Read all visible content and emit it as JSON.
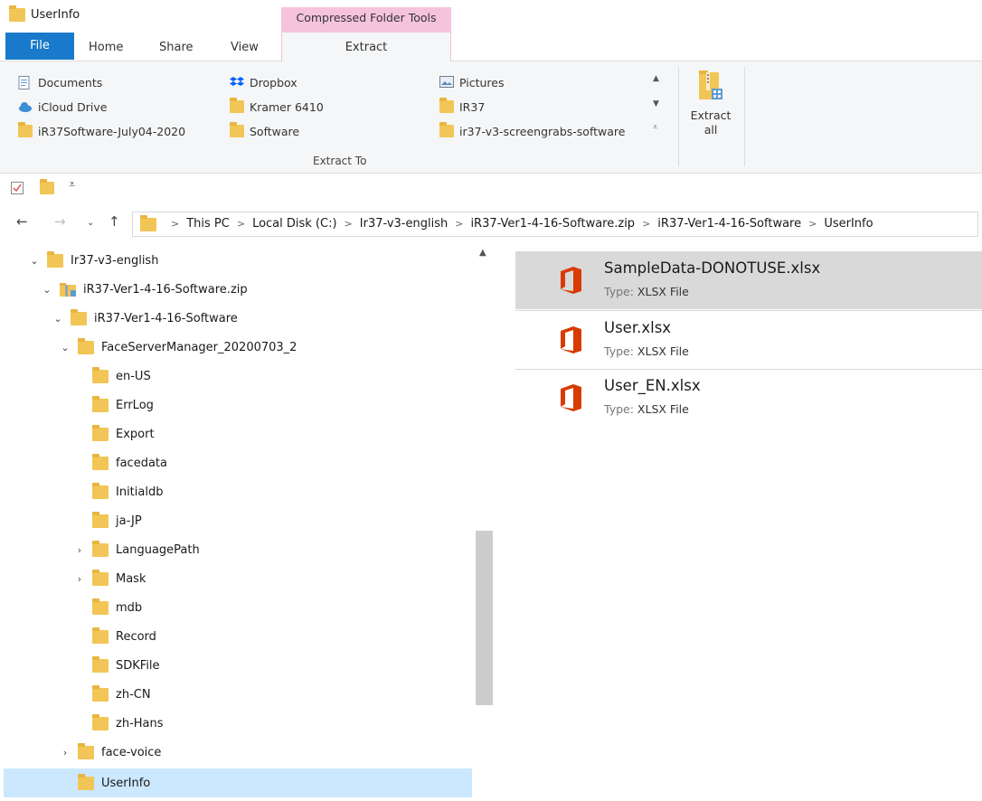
{
  "window": {
    "title": "UserInfo"
  },
  "ribbon": {
    "context_header": "Compressed Folder Tools",
    "tabs": {
      "file": "File",
      "home": "Home",
      "share": "Share",
      "view": "View",
      "extract": "Extract"
    },
    "extract_to": {
      "label": "Extract To",
      "columns": [
        [
          {
            "label": "Documents",
            "icon": "documents-icon"
          },
          {
            "label": "iCloud Drive",
            "icon": "icloud-icon"
          },
          {
            "label": "iR37Software-July04-2020",
            "icon": "folder-icon"
          }
        ],
        [
          {
            "label": "Dropbox",
            "icon": "dropbox-icon"
          },
          {
            "label": "Kramer 6410",
            "icon": "folder-icon"
          },
          {
            "label": "Software",
            "icon": "folder-icon"
          }
        ],
        [
          {
            "label": "Pictures",
            "icon": "pictures-icon"
          },
          {
            "label": "IR37",
            "icon": "folder-icon"
          },
          {
            "label": "ir37-v3-screengrabs-software",
            "icon": "folder-icon"
          }
        ]
      ]
    },
    "extract_all": {
      "line1": "Extract",
      "line2": "all"
    }
  },
  "address": {
    "crumbs": [
      "This PC",
      "Local Disk (C:)",
      "Ir37-v3-english",
      "iR37-Ver1-4-16-Software.zip",
      "iR37-Ver1-4-16-Software",
      "UserInfo"
    ]
  },
  "tree": [
    {
      "label": "Ir37-v3-english",
      "chevron": "expanded",
      "icon": "folder-icon"
    },
    {
      "label": "iR37-Ver1-4-16-Software.zip",
      "chevron": "expanded",
      "icon": "zip-folder-icon"
    },
    {
      "label": "iR37-Ver1-4-16-Software",
      "chevron": "expanded",
      "icon": "folder-icon"
    },
    {
      "label": "FaceServerManager_20200703_2",
      "chevron": "expanded",
      "icon": "folder-icon"
    },
    {
      "label": "en-US",
      "chevron": "none",
      "icon": "folder-icon"
    },
    {
      "label": "ErrLog",
      "chevron": "none",
      "icon": "folder-icon"
    },
    {
      "label": "Export",
      "chevron": "none",
      "icon": "folder-icon"
    },
    {
      "label": "facedata",
      "chevron": "none",
      "icon": "folder-icon"
    },
    {
      "label": "Initialdb",
      "chevron": "none",
      "icon": "folder-icon"
    },
    {
      "label": "ja-JP",
      "chevron": "none",
      "icon": "folder-icon"
    },
    {
      "label": "LanguagePath",
      "chevron": "collapsed",
      "icon": "folder-icon"
    },
    {
      "label": "Mask",
      "chevron": "collapsed",
      "icon": "folder-icon"
    },
    {
      "label": "mdb",
      "chevron": "none",
      "icon": "folder-icon"
    },
    {
      "label": "Record",
      "chevron": "none",
      "icon": "folder-icon"
    },
    {
      "label": "SDKFile",
      "chevron": "none",
      "icon": "folder-icon"
    },
    {
      "label": "zh-CN",
      "chevron": "none",
      "icon": "folder-icon"
    },
    {
      "label": "zh-Hans",
      "chevron": "none",
      "icon": "folder-icon"
    },
    {
      "label": "face-voice",
      "chevron": "collapsed",
      "icon": "folder-icon"
    },
    {
      "label": "UserInfo",
      "chevron": "none",
      "icon": "folder-icon",
      "selected": true
    }
  ],
  "files": [
    {
      "name": "SampleData-DONOTUSE.xlsx",
      "type_label": "Type:",
      "type": "XLSX File",
      "selected": true
    },
    {
      "name": "User.xlsx",
      "type_label": "Type:",
      "type": "XLSX File"
    },
    {
      "name": "User_EN.xlsx",
      "type_label": "Type:",
      "type": "XLSX File"
    }
  ],
  "colors": {
    "file_tab": "#1979ca",
    "context_tab": "#f5c3dc",
    "selection": "#cce8ff",
    "folder": "#f2c656",
    "office": "#d83b01"
  }
}
